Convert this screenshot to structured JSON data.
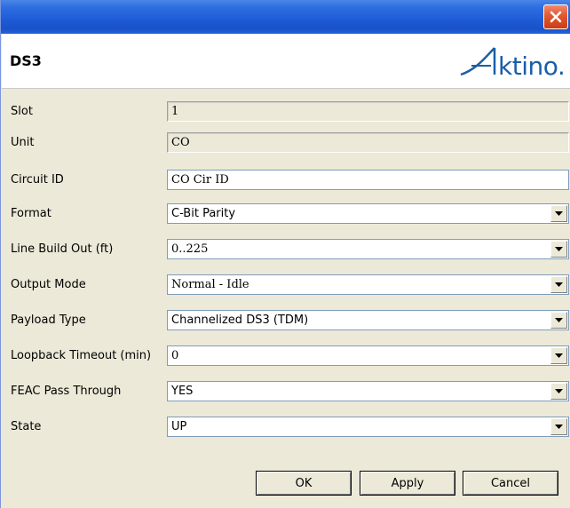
{
  "window": {
    "close_label": "✕"
  },
  "header": {
    "title": "DS3",
    "logo_text": "Aktino."
  },
  "form": {
    "slot": {
      "label": "Slot",
      "value": "1"
    },
    "unit": {
      "label": "Unit",
      "value": "CO"
    },
    "circuit_id": {
      "label": "Circuit ID",
      "value": "CO Cir ID"
    },
    "format": {
      "label": "Format",
      "value": "C-Bit Parity"
    },
    "line_build_out": {
      "label": "Line Build Out (ft)",
      "value": "0..225"
    },
    "output_mode": {
      "label": "Output Mode",
      "value": "Normal - Idle"
    },
    "payload_type": {
      "label": "Payload Type",
      "value": "Channelized DS3 (TDM)"
    },
    "loopback_timeout": {
      "label": "Loopback Timeout (min)",
      "value": "0"
    },
    "feac_pass_through": {
      "label": "FEAC Pass Through",
      "value": "YES"
    },
    "state": {
      "label": "State",
      "value": "UP"
    }
  },
  "buttons": {
    "ok": "OK",
    "apply": "Apply",
    "cancel": "Cancel"
  },
  "colors": {
    "titlebar": "#1e5bd6",
    "close": "#e2582f",
    "logo": "#1a5ea8",
    "background": "#ece9d8"
  },
  "icons": {
    "close": "close-icon",
    "dropdown": "chevron-down-icon"
  }
}
